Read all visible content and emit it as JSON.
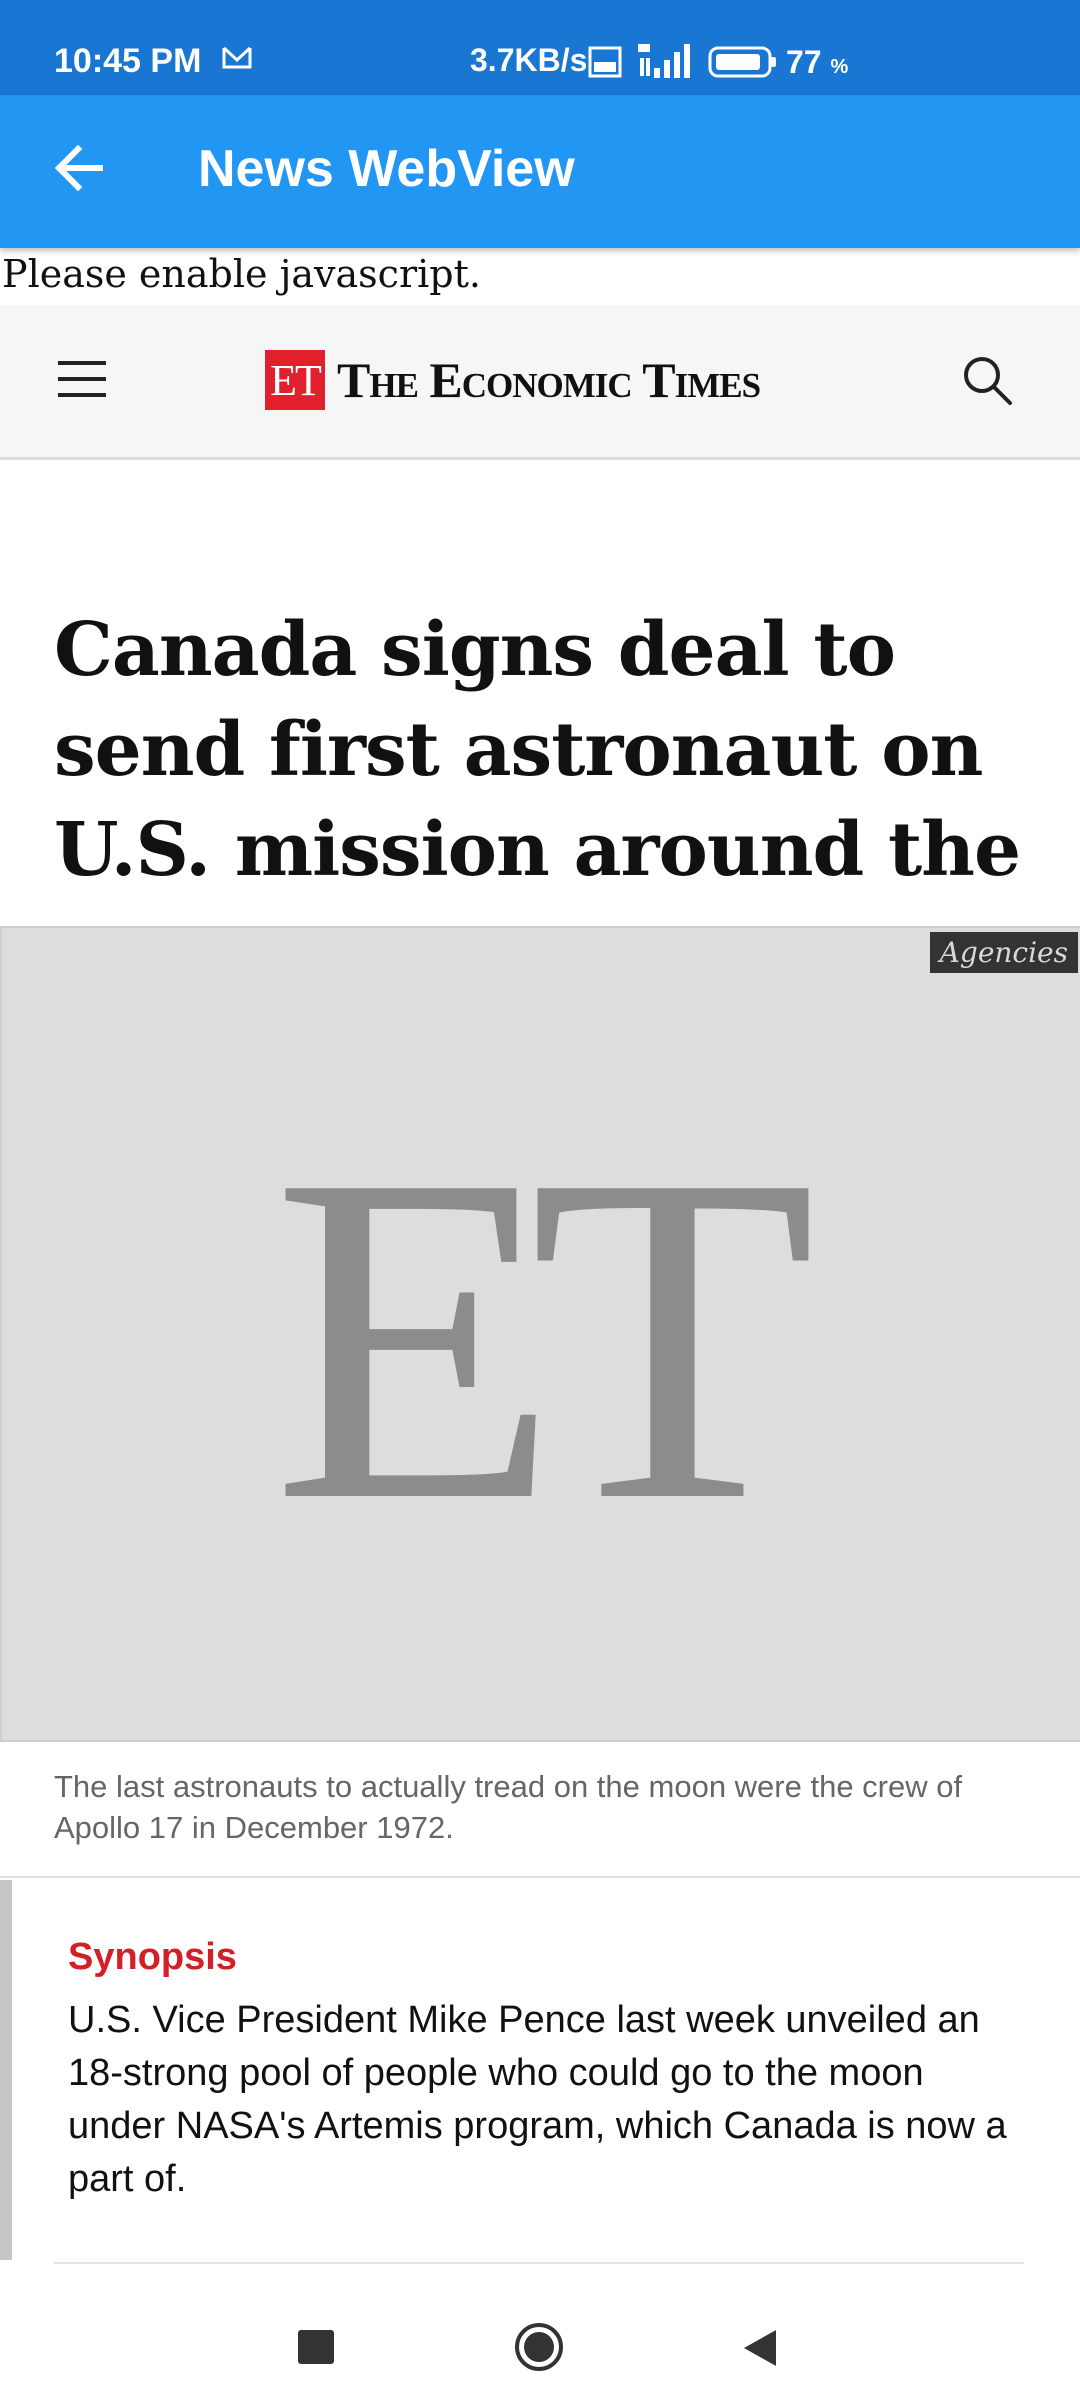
{
  "status_bar": {
    "time": "10:45 PM",
    "net_speed": "3.7KB/s",
    "battery_pct": "77",
    "battery_unit": "%",
    "icons": [
      "gmail-icon",
      "volte-icon",
      "signal-4g-icon",
      "battery-icon"
    ]
  },
  "app_bar": {
    "title": "News WebView",
    "back_icon": "arrow-back-icon"
  },
  "notice": "Please enable javascript.",
  "site_header": {
    "logo_mark": "ET",
    "logo_text": "The Economic Times",
    "menu_icon": "hamburger-menu-icon",
    "search_icon": "search-icon"
  },
  "article": {
    "headline": "Canada signs deal to send first astronaut on U.S. mission around the moon",
    "image": {
      "placeholder_mark": "ET",
      "credit": "Agencies"
    },
    "caption": "The last astronauts to actually tread on the moon were the crew of Apollo 17 in December 1972.",
    "synopsis_label": "Synopsis",
    "synopsis_text": "U.S. Vice President Mike Pence last week unveiled an 18-strong pool of people who could go to the moon under NASA's Artemis program, which Canada is now a part of."
  },
  "nav_bar": {
    "icons": [
      "recents-icon",
      "home-icon",
      "back-triangle-icon"
    ]
  },
  "colors": {
    "status_bar": "#1976d2",
    "app_bar": "#2196f3",
    "logo_red": "#e0202d",
    "synopsis_red": "#d32027"
  }
}
